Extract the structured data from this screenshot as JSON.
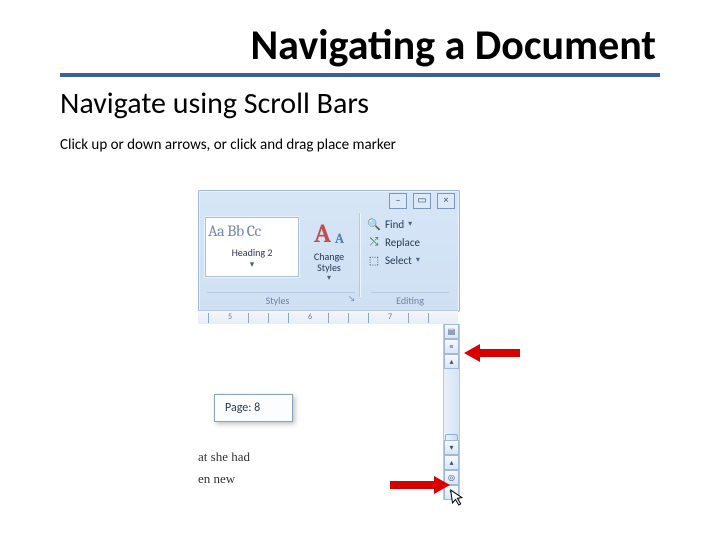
{
  "title": "Navigating a Document",
  "subtitle": "Navigate using Scroll Bars",
  "instruction": "Click up or down arrows, or click and drag place marker",
  "ribbon": {
    "style_preview": "Aa Bb Cc",
    "style_name": "Heading 2",
    "style_expand": "▾",
    "change_styles_label": "Change\nStyles",
    "change_styles_dd": "▾",
    "find_label": "Find",
    "replace_label": "Replace",
    "select_label": "Select",
    "find_dd": "▾",
    "select_dd": "▾",
    "group_styles": "Styles",
    "group_editing": "Editing",
    "styles_launcher": "↘"
  },
  "window": {
    "minimize": "–",
    "close": "×",
    "restore": "▭"
  },
  "ruler": {
    "numbers": [
      "5",
      "6",
      "7"
    ]
  },
  "scrollbar": {
    "tool_split": "▤",
    "tool_ruler": "≡",
    "arrow_up": "▴",
    "arrow_down": "▾",
    "prev_page": "▴",
    "browse_object": "◎",
    "next_page": "▾"
  },
  "tooltip": "Page: 8",
  "doc_lines": {
    "l1": "at she had",
    "l2": "en new"
  },
  "cursor_glyph": "➤"
}
